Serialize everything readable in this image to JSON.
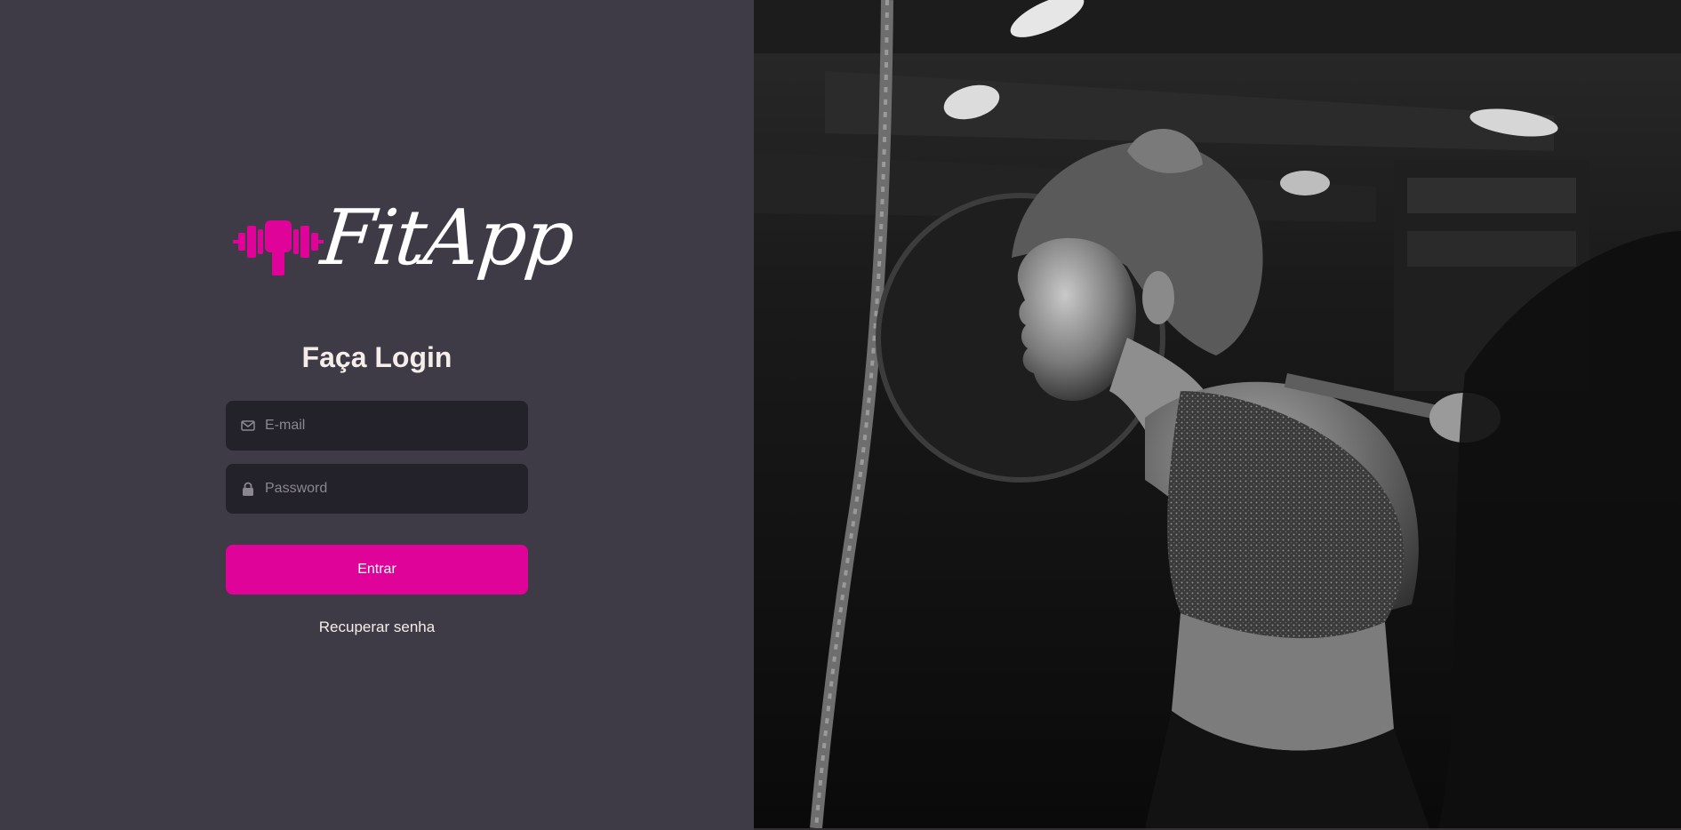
{
  "brand": {
    "name": "FitApp",
    "icon": "dumbbell-icon",
    "accent_color": "#e0039a"
  },
  "login": {
    "title": "Faça Login",
    "email_placeholder": "E-mail",
    "password_placeholder": "Password",
    "submit_label": "Entrar",
    "recover_label": "Recuperar senha"
  },
  "icons": {
    "email": "mail-icon",
    "password": "lock-icon"
  },
  "colors": {
    "panel_bg": "#3e3b47",
    "input_bg": "#232129",
    "text": "#f4ede8",
    "placeholder": "#8a8791"
  },
  "hero_image": {
    "subject": "gym-athlete-photo",
    "style": "black-and-white"
  }
}
